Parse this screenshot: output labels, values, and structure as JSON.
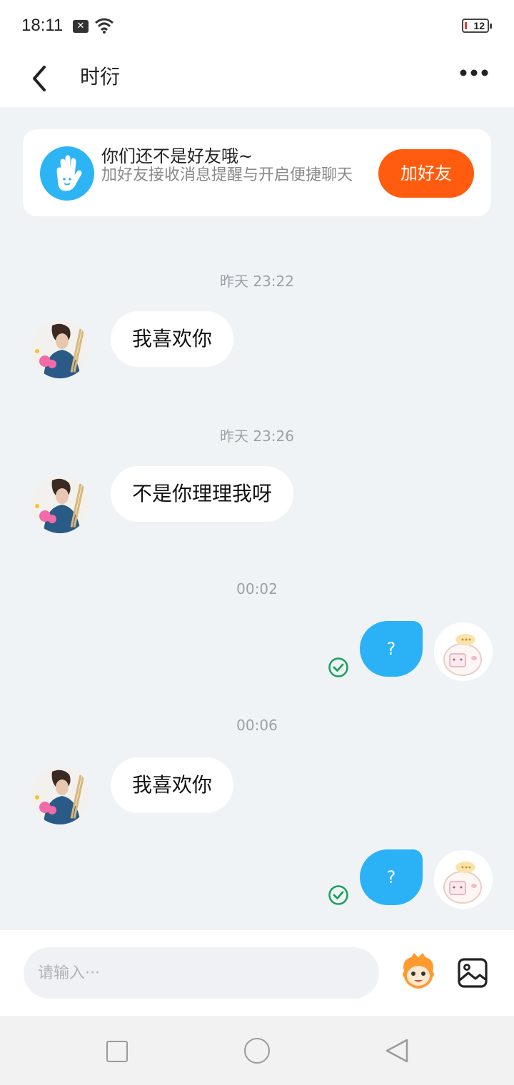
{
  "status_bar": {
    "time": "18:11",
    "x_badge": "✕",
    "battery": "12",
    "battery_color": "#e53935"
  },
  "header": {
    "title": "时衍",
    "back_icon": "chevron-left-icon",
    "more_icon": "more-dots-icon"
  },
  "banner": {
    "title": "你们还不是好友哦~",
    "subtitle": "加好友接收消息提醒与开启便捷聊天",
    "button_label": "加好友",
    "icon": "hand-wave-icon",
    "accent": "#ff5c0f",
    "icon_color": "#2db4f5"
  },
  "messages": [
    {
      "timestamp": "昨天 23:22",
      "side": "left",
      "text": "我喜欢你"
    },
    {
      "timestamp": "昨天 23:26",
      "side": "left",
      "text": "不是你理理我呀"
    },
    {
      "timestamp": "00:02",
      "side": "right",
      "text": "?",
      "status_icon": "check-circle-icon"
    },
    {
      "timestamp": "00:06",
      "side": "left",
      "text": "我喜欢你"
    },
    {
      "timestamp": "",
      "side": "right",
      "text": "?",
      "status_icon": "check-circle-icon"
    }
  ],
  "input": {
    "placeholder": "请输入···",
    "value": "",
    "emoji_icon": "mascot-emoji-icon",
    "image_icon": "image-icon"
  },
  "nav": {
    "recent_icon": "square-icon",
    "home_icon": "circle-icon",
    "back_icon": "triangle-back-icon"
  },
  "colors": {
    "outgoing_bubble": "#2bb2f6",
    "background": "#f0f3f6",
    "check_green": "#18a058"
  }
}
